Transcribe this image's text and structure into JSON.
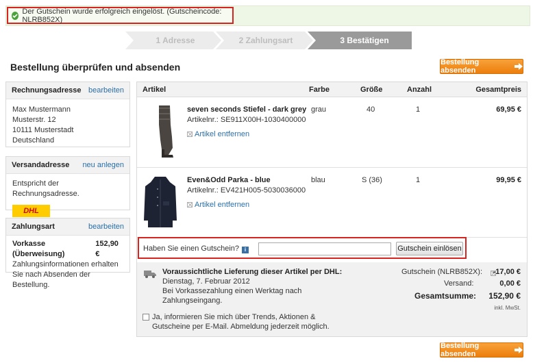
{
  "banner": {
    "text": "Der Gutschein wurde erfolgreich eingelöst. (Gutscheincode: NLRB852X)"
  },
  "steps": [
    {
      "label": "1 Adresse"
    },
    {
      "label": "2 Zahlungsart"
    },
    {
      "label": "3 Bestätigen"
    }
  ],
  "page": {
    "title": "Bestellung überprüfen und absenden",
    "submit_label": "Bestellung absenden"
  },
  "billing": {
    "title": "Rechnungsadresse",
    "edit": "bearbeiten",
    "lines": [
      "Max Mustermann",
      "Musterstr. 12",
      "10111 Musterstadt",
      "Deutschland"
    ]
  },
  "shipping": {
    "title": "Versandadresse",
    "new": "neu anlegen",
    "text": "Entspricht der Rechnungsadresse.",
    "carrier": "DHL"
  },
  "payment": {
    "title": "Zahlungsart",
    "edit": "bearbeiten",
    "method": "Vorkasse (Überweisung)",
    "amount": "152,90 €",
    "note": "Zahlungsinformationen erhalten Sie nach Absenden der Bestellung."
  },
  "table": {
    "headers": {
      "article": "Artikel",
      "color": "Farbe",
      "size": "Größe",
      "qty": "Anzahl",
      "total": "Gesamtpreis"
    },
    "remove_label": "Artikel entfernen",
    "items": [
      {
        "name": "seven seconds Stiefel - dark grey",
        "sku": "Artikelnr.: SE911X00H-1030400000",
        "color": "grau",
        "size": "40",
        "qty": "1",
        "price": "69,95 €"
      },
      {
        "name": "Even&Odd Parka - blue",
        "sku": "Artikelnr.: EV421H005-5030036000",
        "color": "blau",
        "size": "S (36)",
        "qty": "1",
        "price": "99,95 €"
      }
    ]
  },
  "voucher": {
    "question": "Haben Sie einen Gutschein?",
    "info_icon": "i",
    "input_value": "",
    "button": "Gutschein einlösen"
  },
  "delivery": {
    "title": "Voraussichtliche Lieferung dieser Artikel per DHL:",
    "date": "Dienstag, 7. Februar 2012",
    "note_line1": "Bei Vorkassezahlung einen Werktag nach",
    "note_line2": "Zahlungseingang.",
    "newsletter_line1": "Ja, informieren Sie mich über Trends, Aktionen &",
    "newsletter_line2": "Gutscheine per E-Mail. Abmeldung jederzeit möglich."
  },
  "summary": {
    "voucher_label": "Gutschein (NLRB852X):",
    "voucher_value": "-17,00 €",
    "shipping_label": "Versand:",
    "shipping_value": "0,00 €",
    "total_label": "Gesamtsumme:",
    "total_value": "152,90 €",
    "vat_note": "inkl. MwSt."
  },
  "colors": {
    "accent": "#ec7e0c",
    "highlight": "#d9231f",
    "link": "#2a6fa8",
    "success": "#4aa33a"
  }
}
